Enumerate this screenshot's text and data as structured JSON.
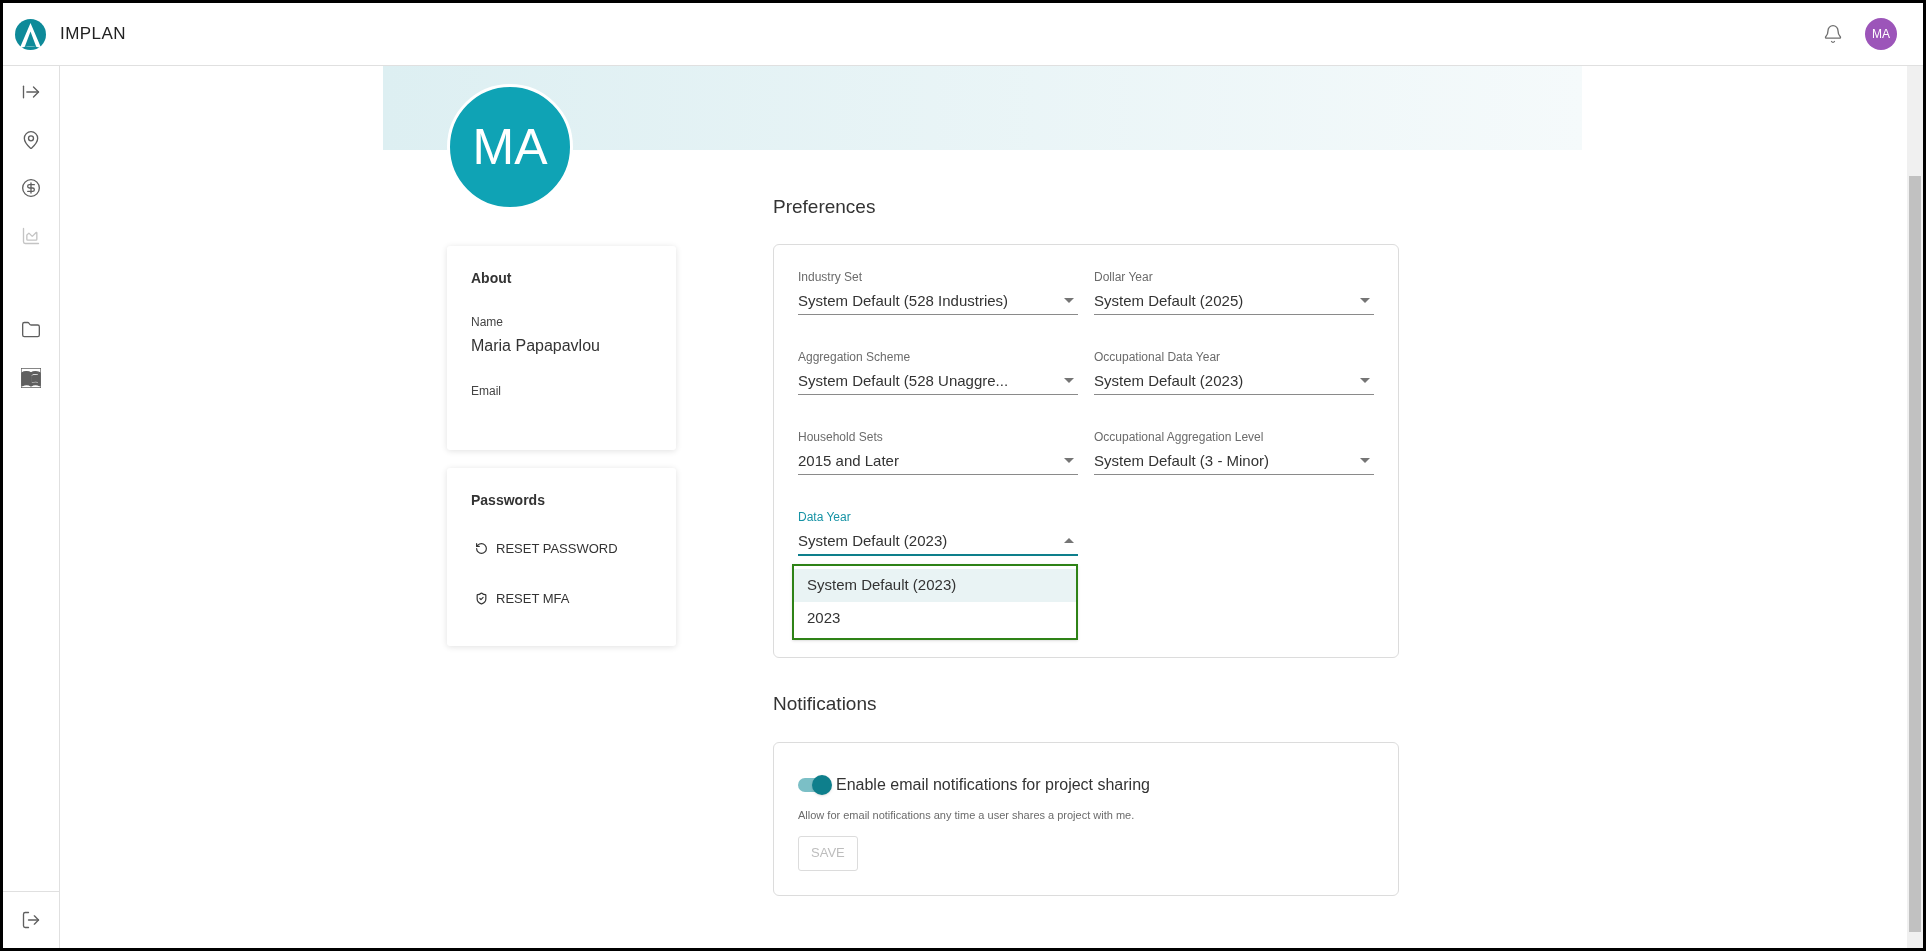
{
  "header": {
    "brand": "IMPLAN",
    "user_initials": "MA"
  },
  "sidebar": {
    "groups": [
      [
        {
          "kind": "expand",
          "disabled": false
        },
        {
          "kind": "location",
          "disabled": false
        },
        {
          "kind": "dollar",
          "disabled": false
        },
        {
          "kind": "chart",
          "disabled": true
        }
      ],
      [
        {
          "kind": "folder",
          "disabled": false
        },
        {
          "kind": "book",
          "disabled": false
        }
      ]
    ],
    "footer": {
      "kind": "logout",
      "disabled": false
    }
  },
  "profile": {
    "initials": "MA",
    "about": {
      "title": "About",
      "fields": [
        {
          "label": "Name",
          "value": "Maria Papapavlou"
        },
        {
          "label": "Email"
        }
      ]
    },
    "passwords": {
      "title": "Passwords",
      "actions": [
        {
          "kind": "reset",
          "label": "RESET PASSWORD"
        },
        {
          "kind": "mfa",
          "label": "RESET MFA"
        }
      ]
    }
  },
  "preferences": {
    "title": "Preferences",
    "fields": [
      {
        "label": "Industry Set",
        "value": "System Default (528 Industries)",
        "expanded": false
      },
      {
        "label": "Dollar Year",
        "value": "System Default (2025)",
        "expanded": false
      },
      {
        "label": "Aggregation Scheme",
        "value": "System Default (528 Unaggre...",
        "expanded": false
      },
      {
        "label": "Occupational Data Year",
        "value": "System Default (2023)",
        "expanded": false
      },
      {
        "label": "Household Sets",
        "value": "2015 and Later",
        "expanded": false
      },
      {
        "label": "Occupational Aggregation Level",
        "value": "System Default (3 - Minor)",
        "expanded": false
      },
      {
        "label": "Data Year",
        "value": "System Default (2023)",
        "expanded": true,
        "options": [
          {
            "label": "System Default (2023)",
            "selected": true
          },
          {
            "label": "2023",
            "selected": false
          }
        ]
      }
    ]
  },
  "notifications": {
    "title": "Notifications",
    "toggle": {
      "label": "Enable email notifications for project sharing",
      "on": true
    },
    "description": "Allow for email notifications any time a user shares a project with me.",
    "save_button": {
      "label": "SAVE",
      "disabled": true
    }
  }
}
